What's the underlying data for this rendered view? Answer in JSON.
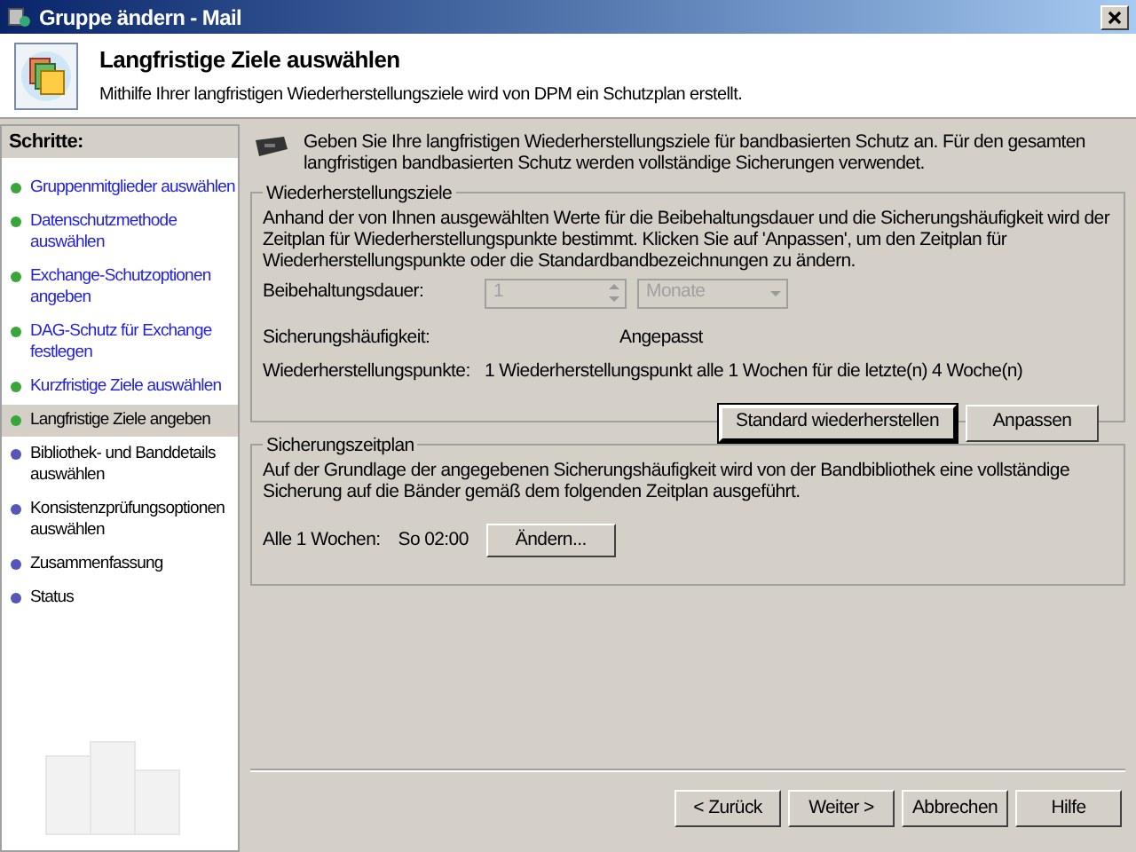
{
  "window": {
    "title": "Gruppe ändern - Mail"
  },
  "header": {
    "title": "Langfristige Ziele auswählen",
    "subtitle": "Mithilfe Ihrer langfristigen Wiederherstellungsziele wird von DPM ein Schutzplan erstellt."
  },
  "sidebar": {
    "title": "Schritte:",
    "items": [
      {
        "label": "Gruppenmitglieder auswählen",
        "completed": true,
        "selected": false
      },
      {
        "label": "Datenschutzmethode auswählen",
        "completed": true,
        "selected": false
      },
      {
        "label": "Exchange-Schutzoptionen angeben",
        "completed": true,
        "selected": false
      },
      {
        "label": "DAG-Schutz für Exchange festlegen",
        "completed": true,
        "selected": false
      },
      {
        "label": "Kurzfristige Ziele auswählen",
        "completed": true,
        "selected": false
      },
      {
        "label": "Langfristige Ziele angeben",
        "completed": true,
        "selected": true
      },
      {
        "label": "Bibliothek- und Banddetails auswählen",
        "completed": false,
        "selected": false
      },
      {
        "label": "Konsistenzprüfungsoptionen auswählen",
        "completed": false,
        "selected": false
      },
      {
        "label": "Zusammenfassung",
        "completed": false,
        "selected": false
      },
      {
        "label": "Status",
        "completed": false,
        "selected": false
      }
    ]
  },
  "intro": "Geben Sie Ihre langfristigen Wiederherstellungsziele für bandbasierten Schutz an. Für den gesamten langfristigen bandbasierten Schutz werden vollständige Sicherungen verwendet.",
  "recovery_goals": {
    "legend": "Wiederherstellungsziele",
    "description": "Anhand der von Ihnen ausgewählten Werte für die Beibehaltungsdauer und die Sicherungshäufigkeit wird der Zeitplan für Wiederherstellungspunkte bestimmt. Klicken Sie auf 'Anpassen', um den Zeitplan für Wiederherstellungspunkte oder die Standardbandbezeichnungen zu ändern.",
    "retention_label": "Beibehaltungsdauer:",
    "retention_value": "1",
    "retention_unit": "Monate",
    "disabled": true,
    "frequency_label": "Sicherungshäufigkeit:",
    "frequency_value": "Angepasst",
    "points_label": "Wiederherstellungspunkte:",
    "points_value": "1 Wiederherstellungspunkt alle 1 Wochen für die letzte(n) 4 Woche(n)",
    "buttons": [
      "Standard wiederherstellen",
      "Anpassen"
    ]
  },
  "backup_schedule": {
    "legend": "Sicherungszeitplan",
    "description": "Auf der Grundlage der angegebenen Sicherungshäufigkeit wird von der Bandbibliothek eine vollständige Sicherung auf die Bänder gemäß dem folgenden Zeitplan ausgeführt.",
    "interval": "Alle 1 Wochen:",
    "time": "So 02:00",
    "button": "Ändern..."
  },
  "footer_buttons": [
    "< Zurück",
    "Weiter >",
    "Abbrechen",
    "Hilfe"
  ]
}
